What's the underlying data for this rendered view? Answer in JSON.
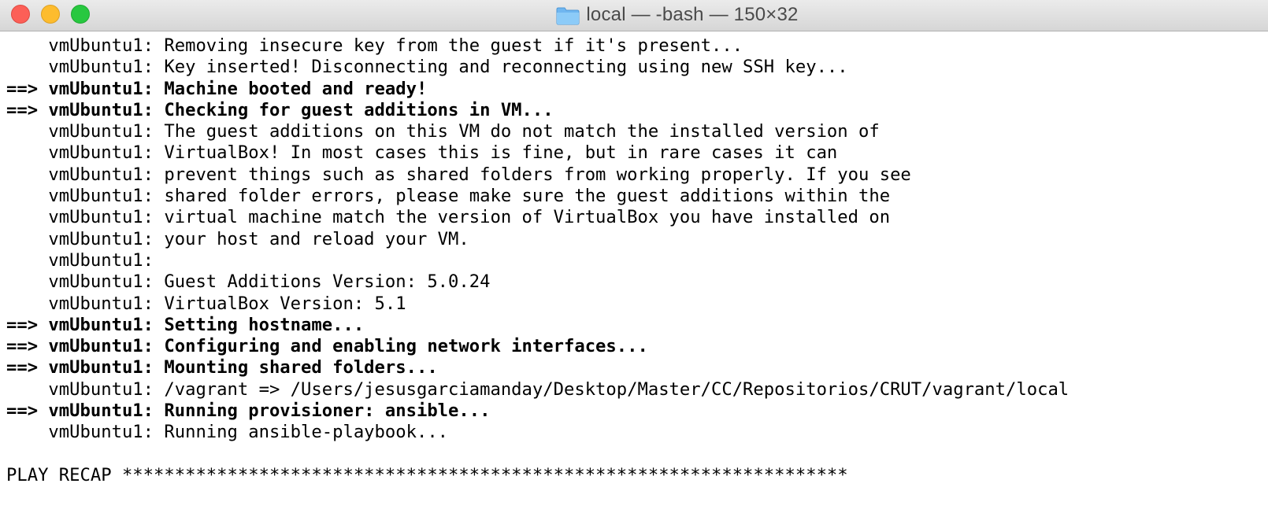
{
  "window": {
    "title": "local — -bash — 150×32"
  },
  "terminal": {
    "lines": [
      {
        "text": "    vmUbuntu1: Removing insecure key from the guest if it's present...",
        "bold": false
      },
      {
        "text": "    vmUbuntu1: Key inserted! Disconnecting and reconnecting using new SSH key...",
        "bold": false
      },
      {
        "text": "==> vmUbuntu1: Machine booted and ready!",
        "bold": true
      },
      {
        "text": "==> vmUbuntu1: Checking for guest additions in VM...",
        "bold": true
      },
      {
        "text": "    vmUbuntu1: The guest additions on this VM do not match the installed version of",
        "bold": false
      },
      {
        "text": "    vmUbuntu1: VirtualBox! In most cases this is fine, but in rare cases it can",
        "bold": false
      },
      {
        "text": "    vmUbuntu1: prevent things such as shared folders from working properly. If you see",
        "bold": false
      },
      {
        "text": "    vmUbuntu1: shared folder errors, please make sure the guest additions within the",
        "bold": false
      },
      {
        "text": "    vmUbuntu1: virtual machine match the version of VirtualBox you have installed on",
        "bold": false
      },
      {
        "text": "    vmUbuntu1: your host and reload your VM.",
        "bold": false
      },
      {
        "text": "    vmUbuntu1:",
        "bold": false
      },
      {
        "text": "    vmUbuntu1: Guest Additions Version: 5.0.24",
        "bold": false
      },
      {
        "text": "    vmUbuntu1: VirtualBox Version: 5.1",
        "bold": false
      },
      {
        "text": "==> vmUbuntu1: Setting hostname...",
        "bold": true
      },
      {
        "text": "==> vmUbuntu1: Configuring and enabling network interfaces...",
        "bold": true
      },
      {
        "text": "==> vmUbuntu1: Mounting shared folders...",
        "bold": true
      },
      {
        "text": "    vmUbuntu1: /vagrant => /Users/jesusgarciamanday/Desktop/Master/CC/Repositorios/CRUT/vagrant/local",
        "bold": false
      },
      {
        "text": "==> vmUbuntu1: Running provisioner: ansible...",
        "bold": true
      },
      {
        "text": "    vmUbuntu1: Running ansible-playbook...",
        "bold": false
      },
      {
        "text": "",
        "bold": false
      },
      {
        "text": "PLAY RECAP *********************************************************************",
        "bold": false
      }
    ]
  }
}
